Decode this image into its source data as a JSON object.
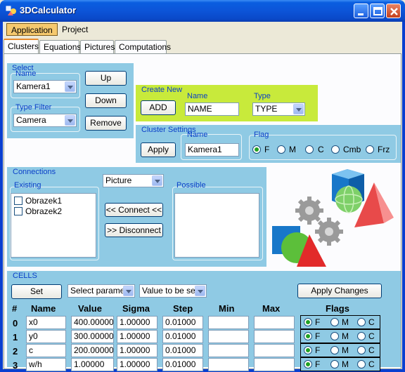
{
  "window": {
    "title": "3DCalculator"
  },
  "menu": [
    "Application",
    "Project"
  ],
  "tabs": [
    "Clusters",
    "Equations",
    "Pictures",
    "Computations"
  ],
  "select_panel": {
    "title": "Select",
    "name_label": "Name",
    "name_value": "Kamera1",
    "type_filter_label": "Type Filter",
    "type_filter_value": "Camera",
    "up_button": "Up",
    "down_button": "Down",
    "remove_button": "Remove"
  },
  "create_new": {
    "title": "Create New",
    "add_button": "ADD",
    "name_label": "Name",
    "name_value": "NAME",
    "type_label": "Type",
    "type_value": "TYPE"
  },
  "cluster_settings": {
    "title": "Cluster Settings",
    "apply_button": "Apply",
    "name_label": "Name",
    "name_value": "Kamera1",
    "flag_label": "Flag",
    "flags": [
      "F",
      "M",
      "C",
      "Cmb",
      "Frz"
    ],
    "selected_flag": "F"
  },
  "connections": {
    "title": "Connections",
    "type_value": "Picture",
    "existing_label": "Existing",
    "existing_items": [
      "Obrazek1",
      "Obrazek2"
    ],
    "possible_label": "Possible",
    "connect_button": "<< Connect <<",
    "disconnect_button": ">> Disconnect"
  },
  "cells": {
    "title": "CELLS",
    "set_button": "Set",
    "param_select": "Select paramete",
    "value_select": "Value to be set",
    "apply_changes_button": "Apply Changes",
    "headers": [
      "#",
      "Name",
      "Value",
      "Sigma",
      "Step",
      "Min",
      "Max",
      "Flags"
    ],
    "flag_options": [
      "F",
      "M",
      "C"
    ],
    "rows": [
      {
        "num": "0",
        "name": "x0",
        "value": "400.00000",
        "sigma": "1.00000",
        "step": "0.01000",
        "min": "",
        "max": ""
      },
      {
        "num": "1",
        "name": "y0",
        "value": "300.00000",
        "sigma": "1.00000",
        "step": "0.01000",
        "min": "",
        "max": ""
      },
      {
        "num": "2",
        "name": "c",
        "value": "200.00000",
        "sigma": "1.00000",
        "step": "0.01000",
        "min": "",
        "max": ""
      },
      {
        "num": "3",
        "name": "w/h",
        "value": "1.00000",
        "sigma": "1.00000",
        "step": "0.01000",
        "min": "",
        "max": ""
      }
    ]
  },
  "colors": {
    "panel": "#8fcae4",
    "create_new": "#c8ea3b",
    "title_bar": "#0a5ee0",
    "label": "#0a3fc8"
  },
  "icons": [
    "app-icon",
    "minimize-icon",
    "maximize-icon",
    "close-icon",
    "dropdown-arrow-icon",
    "shapes-illustration"
  ]
}
